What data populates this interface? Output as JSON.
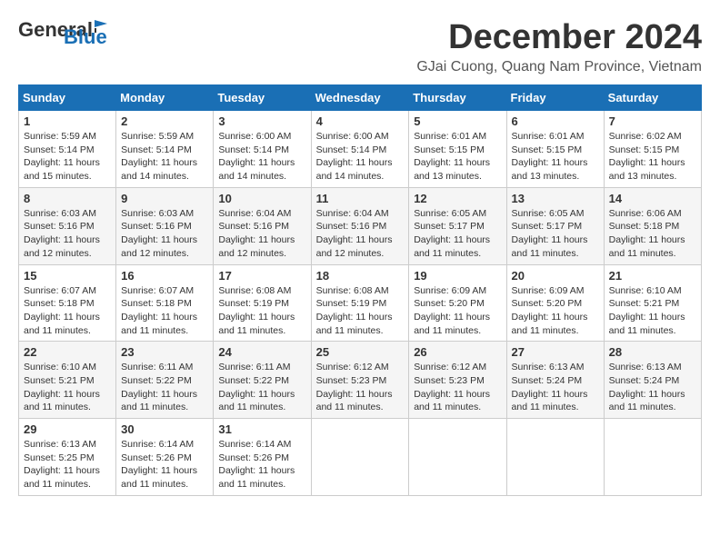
{
  "header": {
    "logo_general": "General",
    "logo_blue": "Blue",
    "month_title": "December 2024",
    "location": "GJai Cuong, Quang Nam Province, Vietnam"
  },
  "days_of_week": [
    "Sunday",
    "Monday",
    "Tuesday",
    "Wednesday",
    "Thursday",
    "Friday",
    "Saturday"
  ],
  "weeks": [
    [
      {
        "day": "1",
        "sunrise": "5:59 AM",
        "sunset": "5:14 PM",
        "daylight": "11 hours and 15 minutes."
      },
      {
        "day": "2",
        "sunrise": "5:59 AM",
        "sunset": "5:14 PM",
        "daylight": "11 hours and 14 minutes."
      },
      {
        "day": "3",
        "sunrise": "6:00 AM",
        "sunset": "5:14 PM",
        "daylight": "11 hours and 14 minutes."
      },
      {
        "day": "4",
        "sunrise": "6:00 AM",
        "sunset": "5:14 PM",
        "daylight": "11 hours and 14 minutes."
      },
      {
        "day": "5",
        "sunrise": "6:01 AM",
        "sunset": "5:15 PM",
        "daylight": "11 hours and 13 minutes."
      },
      {
        "day": "6",
        "sunrise": "6:01 AM",
        "sunset": "5:15 PM",
        "daylight": "11 hours and 13 minutes."
      },
      {
        "day": "7",
        "sunrise": "6:02 AM",
        "sunset": "5:15 PM",
        "daylight": "11 hours and 13 minutes."
      }
    ],
    [
      {
        "day": "8",
        "sunrise": "6:03 AM",
        "sunset": "5:16 PM",
        "daylight": "11 hours and 12 minutes."
      },
      {
        "day": "9",
        "sunrise": "6:03 AM",
        "sunset": "5:16 PM",
        "daylight": "11 hours and 12 minutes."
      },
      {
        "day": "10",
        "sunrise": "6:04 AM",
        "sunset": "5:16 PM",
        "daylight": "11 hours and 12 minutes."
      },
      {
        "day": "11",
        "sunrise": "6:04 AM",
        "sunset": "5:16 PM",
        "daylight": "11 hours and 12 minutes."
      },
      {
        "day": "12",
        "sunrise": "6:05 AM",
        "sunset": "5:17 PM",
        "daylight": "11 hours and 11 minutes."
      },
      {
        "day": "13",
        "sunrise": "6:05 AM",
        "sunset": "5:17 PM",
        "daylight": "11 hours and 11 minutes."
      },
      {
        "day": "14",
        "sunrise": "6:06 AM",
        "sunset": "5:18 PM",
        "daylight": "11 hours and 11 minutes."
      }
    ],
    [
      {
        "day": "15",
        "sunrise": "6:07 AM",
        "sunset": "5:18 PM",
        "daylight": "11 hours and 11 minutes."
      },
      {
        "day": "16",
        "sunrise": "6:07 AM",
        "sunset": "5:18 PM",
        "daylight": "11 hours and 11 minutes."
      },
      {
        "day": "17",
        "sunrise": "6:08 AM",
        "sunset": "5:19 PM",
        "daylight": "11 hours and 11 minutes."
      },
      {
        "day": "18",
        "sunrise": "6:08 AM",
        "sunset": "5:19 PM",
        "daylight": "11 hours and 11 minutes."
      },
      {
        "day": "19",
        "sunrise": "6:09 AM",
        "sunset": "5:20 PM",
        "daylight": "11 hours and 11 minutes."
      },
      {
        "day": "20",
        "sunrise": "6:09 AM",
        "sunset": "5:20 PM",
        "daylight": "11 hours and 11 minutes."
      },
      {
        "day": "21",
        "sunrise": "6:10 AM",
        "sunset": "5:21 PM",
        "daylight": "11 hours and 11 minutes."
      }
    ],
    [
      {
        "day": "22",
        "sunrise": "6:10 AM",
        "sunset": "5:21 PM",
        "daylight": "11 hours and 11 minutes."
      },
      {
        "day": "23",
        "sunrise": "6:11 AM",
        "sunset": "5:22 PM",
        "daylight": "11 hours and 11 minutes."
      },
      {
        "day": "24",
        "sunrise": "6:11 AM",
        "sunset": "5:22 PM",
        "daylight": "11 hours and 11 minutes."
      },
      {
        "day": "25",
        "sunrise": "6:12 AM",
        "sunset": "5:23 PM",
        "daylight": "11 hours and 11 minutes."
      },
      {
        "day": "26",
        "sunrise": "6:12 AM",
        "sunset": "5:23 PM",
        "daylight": "11 hours and 11 minutes."
      },
      {
        "day": "27",
        "sunrise": "6:13 AM",
        "sunset": "5:24 PM",
        "daylight": "11 hours and 11 minutes."
      },
      {
        "day": "28",
        "sunrise": "6:13 AM",
        "sunset": "5:24 PM",
        "daylight": "11 hours and 11 minutes."
      }
    ],
    [
      {
        "day": "29",
        "sunrise": "6:13 AM",
        "sunset": "5:25 PM",
        "daylight": "11 hours and 11 minutes."
      },
      {
        "day": "30",
        "sunrise": "6:14 AM",
        "sunset": "5:26 PM",
        "daylight": "11 hours and 11 minutes."
      },
      {
        "day": "31",
        "sunrise": "6:14 AM",
        "sunset": "5:26 PM",
        "daylight": "11 hours and 11 minutes."
      },
      null,
      null,
      null,
      null
    ]
  ],
  "labels": {
    "sunrise": "Sunrise:",
    "sunset": "Sunset:",
    "daylight": "Daylight:"
  }
}
